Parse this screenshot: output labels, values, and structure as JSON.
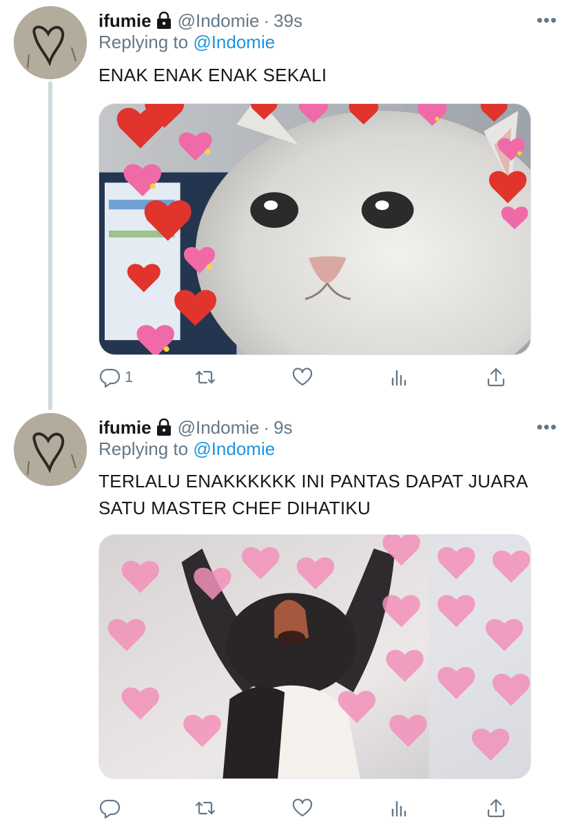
{
  "tweets": [
    {
      "author_name": "ifumie",
      "handle": "@Indomie",
      "separator": "·",
      "time": "39s",
      "replying_prefix": "Replying to",
      "replying_to": "@Indomie",
      "text": "ENAK ENAK ENAK SEKALI",
      "reply_count": "1",
      "media_icons": [
        "crying-cat-with-hearts-image"
      ]
    },
    {
      "author_name": "ifumie",
      "handle": "@Indomie",
      "separator": "·",
      "time": "9s",
      "replying_prefix": "Replying to",
      "replying_to": "@Indomie",
      "text": "TERLALU ENAKKKKKK INI PANTAS DAPAT JUARA SATU MASTER CHEF DIHATIKU",
      "reply_count": "",
      "media_icons": [
        "pingu-with-hearts-image"
      ]
    }
  ],
  "more_glyph": "•••",
  "colors": {
    "secondary_text": "#657786",
    "link": "#1b95e0",
    "primary_text": "#14171a",
    "thread_line": "#cfd9de"
  },
  "icons": [
    "lock-icon",
    "reply-icon",
    "retweet-icon",
    "like-icon",
    "analytics-icon",
    "share-icon",
    "more-icon"
  ]
}
